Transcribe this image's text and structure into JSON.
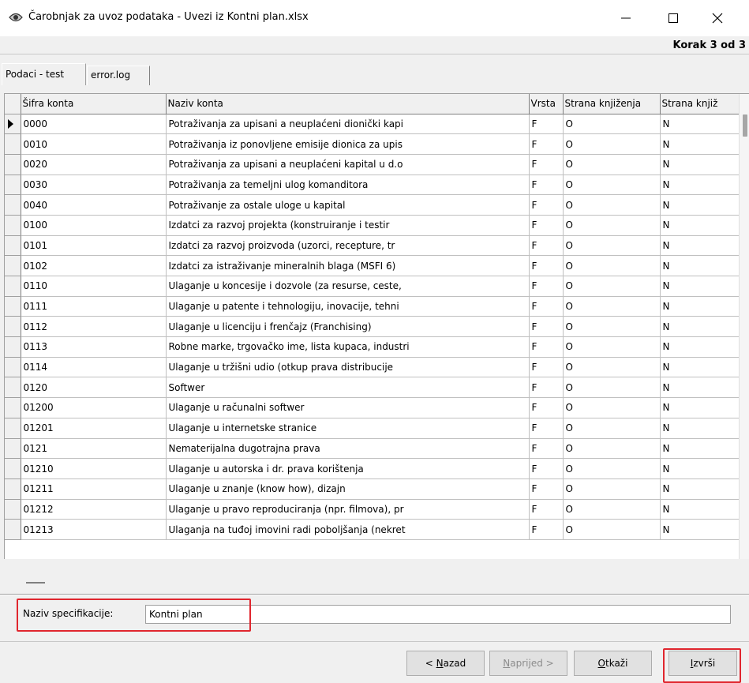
{
  "window": {
    "title": "Čarobnjak za uvoz podataka - Uvezi iz Kontni plan.xlsx",
    "step": "Korak 3 od 3"
  },
  "tabs": [
    {
      "label": "Podaci - test",
      "active": true
    },
    {
      "label": "error.log",
      "active": false
    }
  ],
  "grid": {
    "columns": [
      "Šifra konta",
      "Naziv konta",
      "Vrsta",
      "Strana knjiženja",
      "Strana knjiž"
    ],
    "rows": [
      [
        "0000",
        "Potraživanja za upisani a neuplaćeni dionički kapi",
        "F",
        "O",
        "N"
      ],
      [
        "0010",
        "Potraživanja iz ponovljene emisije dionica za upis",
        "F",
        "O",
        "N"
      ],
      [
        "0020",
        "Potraživanja za upisani a neuplaćeni kapital u d.o",
        "F",
        "O",
        "N"
      ],
      [
        "0030",
        "Potraživanja za temeljni ulog komanditora",
        "F",
        "O",
        "N"
      ],
      [
        "0040",
        "Potraživanje za ostale uloge u kapital",
        "F",
        "O",
        "N"
      ],
      [
        "0100",
        "Izdatci za razvoj projekta (konstruiranje i testir",
        "F",
        "O",
        "N"
      ],
      [
        "0101",
        "Izdatci za razvoj proizvoda (uzorci, recepture, tr",
        "F",
        "O",
        "N"
      ],
      [
        "0102",
        "Izdatci za istraživanje mineralnih blaga (MSFI 6)",
        "F",
        "O",
        "N"
      ],
      [
        "0110",
        "Ulaganje u koncesije i dozvole (za resurse, ceste,",
        "F",
        "O",
        "N"
      ],
      [
        "0111",
        "Ulaganje u patente i tehnologiju, inovacije, tehni",
        "F",
        "O",
        "N"
      ],
      [
        "0112",
        "Ulaganje u licenciju i frenčajz (Franchising)",
        "F",
        "O",
        "N"
      ],
      [
        "0113",
        "Robne marke, trgovačko ime, lista kupaca, industri",
        "F",
        "O",
        "N"
      ],
      [
        "0114",
        "Ulaganje u tržišni udio (otkup prava distribucije",
        "F",
        "O",
        "N"
      ],
      [
        "0120",
        "Softwer",
        "F",
        "O",
        "N"
      ],
      [
        "01200",
        "Ulaganje u računalni softwer",
        "F",
        "O",
        "N"
      ],
      [
        "01201",
        "Ulaganje u internetske stranice",
        "F",
        "O",
        "N"
      ],
      [
        "0121",
        "Nematerijalna dugotrajna prava",
        "F",
        "O",
        "N"
      ],
      [
        "01210",
        "Ulaganje u autorska i dr. prava korištenja",
        "F",
        "O",
        "N"
      ],
      [
        "01211",
        "Ulaganje u znanje (know how), dizajn",
        "F",
        "O",
        "N"
      ],
      [
        "01212",
        "Ulaganje u pravo reproduciranja (npr. filmova), pr",
        "F",
        "O",
        "N"
      ],
      [
        "01213",
        "Ulaganja na tuđoj imovini radi poboljšanja (nekret",
        "F",
        "O",
        "N"
      ]
    ]
  },
  "spec": {
    "label": "Naziv specifikacije:",
    "value": "Kontni plan"
  },
  "buttons": {
    "back_prefix": "< ",
    "back_key": "N",
    "back_rest": "azad",
    "next_key": "N",
    "next_rest": "aprijed >",
    "cancel_key": "O",
    "cancel_rest": "tkaži",
    "run_key": "I",
    "run_rest": "zvrši"
  },
  "icons": {
    "app": "eye-icon",
    "minimize": "minimize-icon",
    "maximize": "maximize-icon",
    "close": "close-icon",
    "row_pointer": "row-pointer-icon"
  }
}
